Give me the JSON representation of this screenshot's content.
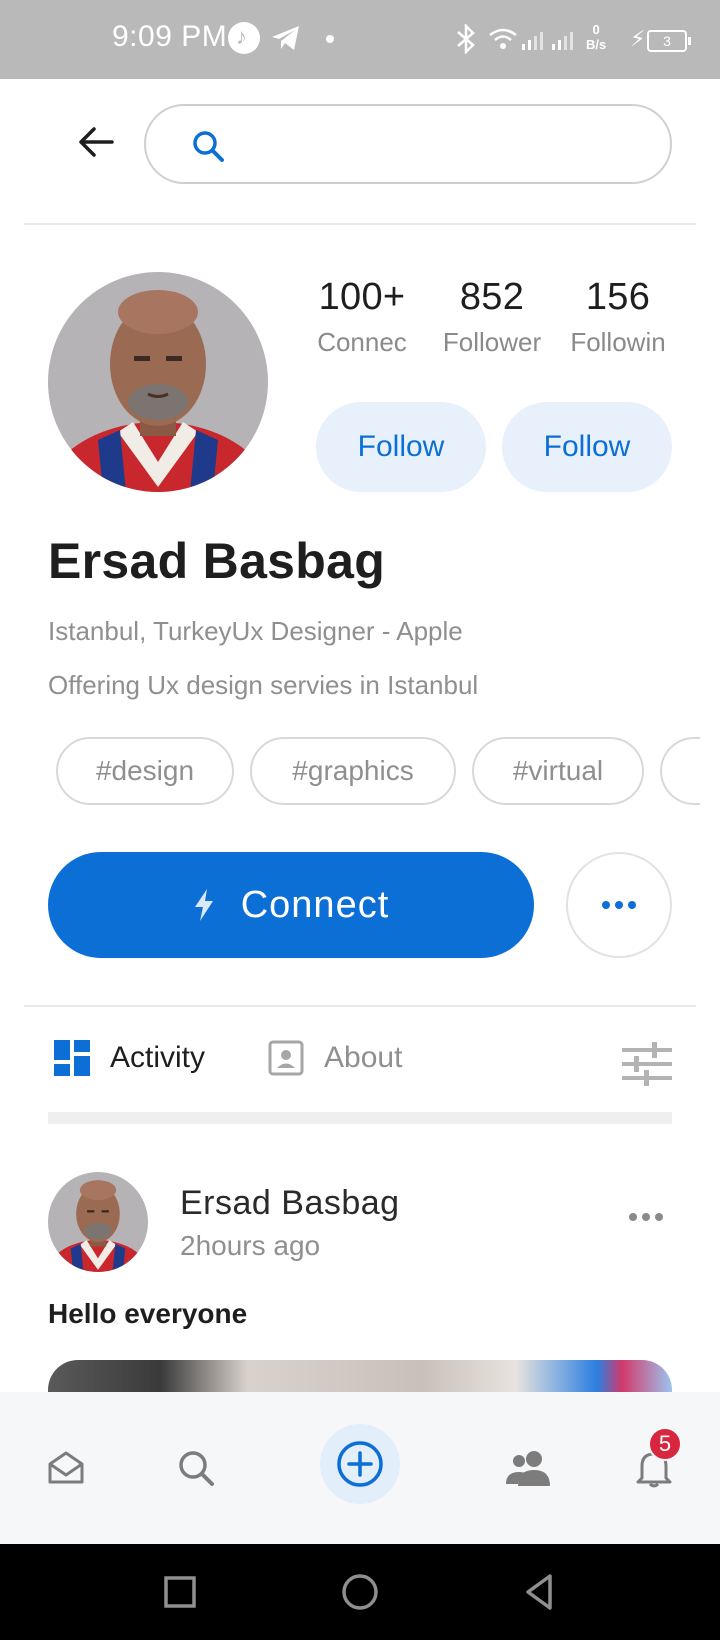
{
  "status_bar": {
    "time": "9:09 PM",
    "network_speed_value": "0",
    "network_speed_unit": "B/s",
    "battery_level": "3"
  },
  "header": {
    "search_placeholder": "",
    "search_value": ""
  },
  "profile": {
    "name": "Ersad Basbag",
    "location_title": "Istanbul, TurkeyUx Designer - Apple",
    "description": "Offering Ux design servies in Istanbul",
    "stats": [
      {
        "value": "100+",
        "label": "Connec"
      },
      {
        "value": "852",
        "label": "Follower"
      },
      {
        "value": "156",
        "label": "Followin"
      }
    ],
    "follow_buttons": [
      "Follow",
      "Follow"
    ],
    "tags": [
      "#design",
      "#graphics",
      "#virtual",
      ""
    ],
    "connect_label": "Connect"
  },
  "tabs": {
    "activity": "Activity",
    "about": "About"
  },
  "post": {
    "author": "Ersad Basbag",
    "time": "2hours ago",
    "text": "Hello everyone"
  },
  "bottom_nav": {
    "notification_count": "5"
  },
  "colors": {
    "primary": "#0b6fd6",
    "primary_light": "#e8f1fb",
    "badge": "#d9263f",
    "muted_text": "#8f8f8f"
  },
  "icons": [
    "back-arrow-icon",
    "search-icon",
    "bolt-icon",
    "more-dots-icon",
    "grid-icon",
    "contact-card-icon",
    "filter-sliders-icon",
    "inbox-icon",
    "add-circle-icon",
    "people-icon",
    "bell-icon"
  ]
}
